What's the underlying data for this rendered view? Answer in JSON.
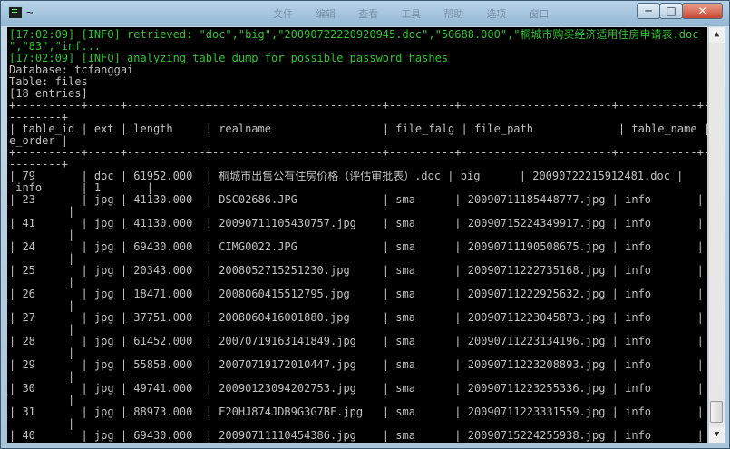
{
  "window": {
    "title": "~",
    "toolbar_ghost": [
      "文件",
      "编辑",
      "查看",
      "工具",
      "帮助",
      "选项",
      "窗口"
    ],
    "min_label": "─",
    "max_label": "□",
    "close_label": "✕"
  },
  "console": {
    "lines": [
      {
        "text": "[17:02:09] [INFO] retrieved: \"doc\",\"big\",\"20090722220920945.doc\",\"50688.000\",\"桐城市购买经济适用住房申请表.doc",
        "color": "green"
      },
      {
        "text": "\",\"83\",\"inf...",
        "color": "green"
      },
      {
        "text": "[17:02:09] [INFO] analyzing table dump for possible password hashes",
        "color": "green"
      },
      {
        "text": "Database: tcfanggai",
        "color": "gray"
      },
      {
        "text": "Table: files",
        "color": "gray"
      },
      {
        "text": "[18 entries]",
        "color": "gray"
      },
      {
        "text": "+----------+-----+------------+--------------------------+----------+-----------------------+------------+-----",
        "color": "gray"
      },
      {
        "text": "--------+",
        "color": "gray"
      },
      {
        "text": "| table_id | ext | length     | realname                 | file_falg | file_path             | table_name | tabl",
        "color": "gray"
      },
      {
        "text": "e_order |",
        "color": "gray"
      },
      {
        "text": "+----------+-----+------------+--------------------------+----------+-----------------------+------------+-----",
        "color": "gray"
      },
      {
        "text": "--------+",
        "color": "gray"
      },
      {
        "text": "| 79       | doc | 61952.000  | 桐城市出售公有住房价格（评估审批表）.doc | big      | 20090722215912481.doc |",
        "color": "gray"
      },
      {
        "text": " info      | 1       |",
        "color": "gray"
      },
      {
        "text": "| 23       | jpg | 41130.000  | DSC02686.JPG             | sma      | 20090711185448777.jpg | info       | 1",
        "color": "gray"
      },
      {
        "text": "         |",
        "color": "gray"
      },
      {
        "text": "| 41       | jpg | 41130.000  | 20090711105430757.jpg    | sma      | 20090715224349917.jpg | info       | 1",
        "color": "gray"
      },
      {
        "text": "         |",
        "color": "gray"
      },
      {
        "text": "| 24       | jpg | 69430.000  | CIMG0022.JPG             | sma      | 20090711190508675.jpg | info       | 1",
        "color": "gray"
      },
      {
        "text": "         |",
        "color": "gray"
      },
      {
        "text": "| 25       | jpg | 20343.000  | 2008052715251230.jpg     | sma      | 20090711222735168.jpg | info       | 1",
        "color": "gray"
      },
      {
        "text": "         |",
        "color": "gray"
      },
      {
        "text": "| 26       | jpg | 18471.000  | 2008060415512795.jpg     | sma      | 20090711222925632.jpg | info       | 1",
        "color": "gray"
      },
      {
        "text": "         |",
        "color": "gray"
      },
      {
        "text": "| 27       | jpg | 37751.000  | 2008060416001880.jpg     | sma      | 20090711223045873.jpg | info       | 1",
        "color": "gray"
      },
      {
        "text": "         |",
        "color": "gray"
      },
      {
        "text": "| 28       | jpg | 61452.000  | 20070719163141849.jpg    | sma      | 20090711223134196.jpg | info       | 1",
        "color": "gray"
      },
      {
        "text": "         |",
        "color": "gray"
      },
      {
        "text": "| 29       | jpg | 55858.000  | 20070719172010447.jpg    | sma      | 20090711223208893.jpg | info       | 1",
        "color": "gray"
      },
      {
        "text": "         |",
        "color": "gray"
      },
      {
        "text": "| 30       | jpg | 49741.000  | 20090123094202753.jpg    | sma      | 20090711223255336.jpg | info       | 1",
        "color": "gray"
      },
      {
        "text": "         |",
        "color": "gray"
      },
      {
        "text": "| 31       | jpg | 88973.000  | E20HJ874JDB9G3G7BF.jpg   | sma      | 20090711223331559.jpg | info       | 1",
        "color": "gray"
      },
      {
        "text": "         |",
        "color": "gray"
      },
      {
        "text": "| 40       | jpg | 69430.000  | 20090711110454386.jpg    | sma      | 20090715224255938.jpg | info       | 1",
        "color": "gray"
      }
    ]
  },
  "scrollbar": {
    "up_icon": "▲",
    "down_icon": "▼"
  },
  "colors": {
    "console_bg": "#000000",
    "text_gray": "#c0c0c0",
    "text_green": "#31c431"
  }
}
